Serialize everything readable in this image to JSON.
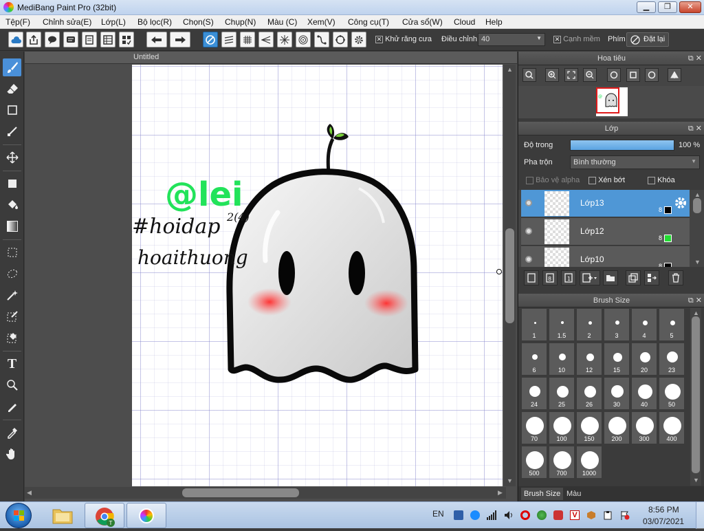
{
  "window": {
    "title": "MediBang Paint Pro (32bit)",
    "min": "▁",
    "max": "❐",
    "close": "✕"
  },
  "menu": [
    "Tệp(F)",
    "Chỉnh sửa(E)",
    "Lớp(L)",
    "Bộ lọc(R)",
    "Chọn(S)",
    "Chụp(N)",
    "Màu (C)",
    "Xem(V)",
    "Công cụ(T)",
    "Cửa sổ(W)",
    "Cloud",
    "Help"
  ],
  "toolbar": {
    "antialias_label": "Khử răng cưa",
    "adjust_label": "Điều chỉnh",
    "adjust_value": "40",
    "smooth_label": "Cạnh mềm",
    "key_label": "Phím",
    "reset_label": "Đặt lại"
  },
  "document": {
    "tab_title": "Untitled"
  },
  "artwork": {
    "handle_text": "@lei",
    "hashtag_text": "#hoidap",
    "hashtag_suffix": "2(4)",
    "name_text": "hoaithuong"
  },
  "navigator": {
    "title": "Hoa tiêu"
  },
  "layers": {
    "title": "Lớp",
    "opacity_label": "Độ trong",
    "opacity_value": "100 %",
    "opacity": 1.0,
    "blend_label": "Pha trộn",
    "blend_value": "Bình thường",
    "protect_alpha": "Bảo vệ alpha",
    "clip": "Xén bớt",
    "lock": "Khóa",
    "rows": [
      {
        "name": "Lớp13",
        "bits": "8",
        "color": "#000000",
        "selected": true
      },
      {
        "name": "Lớp12",
        "bits": "8",
        "color": "#22dd33",
        "selected": false
      },
      {
        "name": "Lớp10",
        "bits": "8",
        "color": "#000000",
        "selected": false
      }
    ]
  },
  "brush_size": {
    "title": "Brush Size",
    "sizes": [
      "1",
      "1.5",
      "2",
      "3",
      "4",
      "5",
      "6",
      "10",
      "12",
      "15",
      "20",
      "23",
      "24",
      "25",
      "26",
      "30",
      "40",
      "50",
      "70",
      "100",
      "150",
      "200",
      "300",
      "400",
      "500",
      "700",
      "1000"
    ],
    "tab_active": "Brush Size",
    "tab_other": "Màu"
  },
  "taskbar": {
    "lang": "EN",
    "time": "8:56 PM",
    "date": "03/07/2021"
  }
}
